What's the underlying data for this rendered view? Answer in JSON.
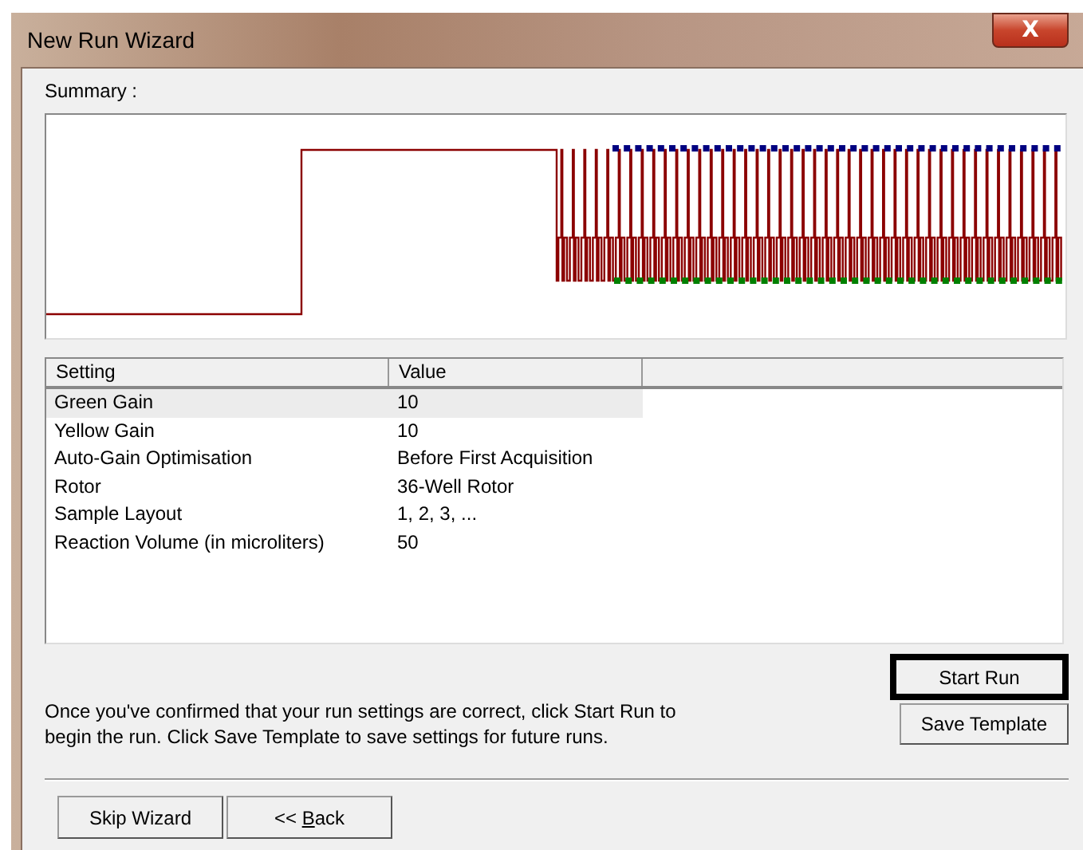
{
  "window": {
    "title": "New Run Wizard",
    "close": "X"
  },
  "summary": {
    "label": "Summary :"
  },
  "table": {
    "columns": [
      "Setting",
      "Value"
    ],
    "rows": [
      {
        "setting": "Green Gain",
        "value": "10",
        "selected": true
      },
      {
        "setting": "Yellow Gain",
        "value": "10",
        "selected": false
      },
      {
        "setting": "Auto-Gain Optimisation",
        "value": "Before First Acquisition",
        "selected": false
      },
      {
        "setting": "Rotor",
        "value": "36-Well Rotor",
        "selected": false
      },
      {
        "setting": "Sample Layout",
        "value": "1, 2, 3, ...",
        "selected": false
      },
      {
        "setting": "Reaction Volume (in microliters)",
        "value": "50",
        "selected": false
      }
    ]
  },
  "message": "Once you've confirmed that your run settings are correct, click Start Run to begin the run. Click Save Template to save settings for future runs.",
  "buttons": [
    {
      "label": "Start Run",
      "default": true
    },
    {
      "label": "Save Template",
      "default": false
    }
  ],
  "footer_buttons": [
    {
      "label_parts": [
        {
          "text": "Skip Wizard",
          "underlined": false
        }
      ]
    },
    {
      "label_parts": [
        {
          "text": "<< ",
          "underlined": false
        },
        {
          "text": "B",
          "underlined": true
        },
        {
          "text": "ack",
          "underlined": false
        }
      ]
    }
  ]
}
